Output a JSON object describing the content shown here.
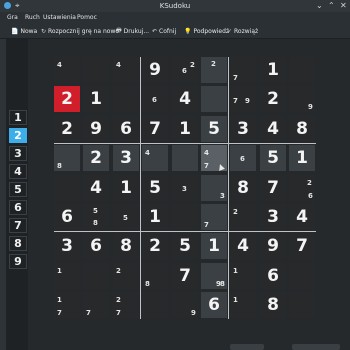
{
  "window": {
    "title": "KSudoku",
    "pin": "⌖",
    "minimize": "⌄",
    "maximize": "⌃",
    "close": "✕"
  },
  "menu": [
    {
      "label": "Gra"
    },
    {
      "label": "Ruch"
    },
    {
      "label": "Ustawienia"
    },
    {
      "label": "Pomoc"
    }
  ],
  "toolbar": [
    {
      "label": "Nowa",
      "icon": "📄"
    },
    {
      "label": "Rozpocznij grę na nowo",
      "icon": "↻"
    },
    {
      "label": "Drukuj...",
      "icon": "🖶"
    },
    {
      "label": "Cofnij",
      "icon": "↶"
    },
    {
      "label": "Podpowiedź",
      "icon": "💡"
    },
    {
      "label": "Rozwiąż",
      "icon": "✓"
    }
  ],
  "number_panel": {
    "selected": "2",
    "buttons": [
      "1",
      "2",
      "3",
      "4",
      "5",
      "6",
      "7",
      "8",
      "9"
    ]
  },
  "board": {
    "selected_cell": {
      "row": 3,
      "col": 5
    },
    "cells": [
      [
        {
          "m": [
            [
              "4",
              "tl"
            ]
          ]
        },
        {},
        {
          "m": [
            [
              "4",
              "tl"
            ]
          ]
        },
        {
          "v": "9"
        },
        {
          "m": [
            [
              "2",
              "tr"
            ],
            [
              "6",
              "mid"
            ]
          ]
        },
        {
          "m": [
            [
              "2",
              "top"
            ]
          ]
        },
        {
          "m": [
            [
              "7",
              "bl"
            ]
          ]
        },
        {
          "v": "1"
        },
        {}
      ],
      [
        {
          "v": "2",
          "err": true
        },
        {
          "v": "1"
        },
        {},
        {
          "m": [
            [
              "6",
              "mid"
            ]
          ]
        },
        {
          "v": "4"
        },
        {},
        {
          "m": [
            [
              "7",
              "ml"
            ],
            [
              "9",
              "mr"
            ]
          ]
        },
        {
          "v": "2"
        },
        {
          "m": [
            [
              "9",
              "br"
            ]
          ]
        }
      ],
      [
        {
          "v": "2"
        },
        {
          "v": "9"
        },
        {
          "v": "6"
        },
        {
          "v": "7"
        },
        {
          "v": "1"
        },
        {
          "v": "5"
        },
        {
          "v": "3"
        },
        {
          "v": "4"
        },
        {
          "v": "8"
        }
      ],
      [
        {
          "m": [
            [
              "8",
              "bl"
            ]
          ]
        },
        {
          "v": "2"
        },
        {
          "v": "3"
        },
        {
          "m": [
            [
              "4",
              "tl"
            ]
          ]
        },
        {},
        {
          "m": [
            [
              "4",
              "tl"
            ],
            [
              "7",
              "bl"
            ]
          ]
        },
        {
          "m": [
            [
              "6",
              "mid"
            ]
          ]
        },
        {
          "v": "5"
        },
        {
          "v": "1"
        }
      ],
      [
        {},
        {
          "v": "4"
        },
        {
          "v": "1"
        },
        {
          "v": "5"
        },
        {
          "m": [
            [
              "3",
              "mid"
            ]
          ]
        },
        {
          "m": [
            [
              "3",
              "br"
            ]
          ]
        },
        {
          "v": "8"
        },
        {
          "v": "7"
        },
        {
          "m": [
            [
              "2",
              "tr"
            ],
            [
              "6",
              "br"
            ]
          ]
        }
      ],
      [
        {
          "v": "6"
        },
        {
          "m": [
            [
              "5",
              "top"
            ],
            [
              "8",
              "bot"
            ]
          ]
        },
        {
          "m": [
            [
              "5",
              "mid"
            ]
          ]
        },
        {
          "v": "1"
        },
        {},
        {
          "m": [
            [
              "7",
              "bl"
            ]
          ]
        },
        {
          "m": [
            [
              "2",
              "tl"
            ]
          ]
        },
        {
          "v": "3"
        },
        {
          "v": "4"
        }
      ],
      [
        {
          "v": "3"
        },
        {
          "v": "6"
        },
        {
          "v": "8"
        },
        {
          "v": "2"
        },
        {
          "v": "5"
        },
        {
          "v": "1"
        },
        {
          "v": "4"
        },
        {
          "v": "9"
        },
        {
          "v": "7"
        }
      ],
      [
        {
          "m": [
            [
              "1",
              "tl"
            ]
          ]
        },
        {},
        {
          "m": [
            [
              "2",
              "tl"
            ]
          ]
        },
        {
          "m": [
            [
              "8",
              "bl"
            ]
          ]
        },
        {
          "v": "7"
        },
        {
          "m": [
            [
              "8",
              "br"
            ],
            [
              "9",
              "br2"
            ]
          ]
        },
        {
          "m": [
            [
              "1",
              "tl"
            ]
          ]
        },
        {
          "v": "6"
        },
        {}
      ],
      [
        {
          "m": [
            [
              "1",
              "tl"
            ],
            [
              "7",
              "bl"
            ]
          ]
        },
        {
          "m": [
            [
              "7",
              "bl"
            ]
          ]
        },
        {
          "m": [
            [
              "2",
              "tl"
            ],
            [
              "7",
              "bl"
            ]
          ]
        },
        {},
        {
          "m": [
            [
              "9",
              "br"
            ]
          ]
        },
        {
          "v": "6"
        },
        {
          "m": [
            [
              "1",
              "tl"
            ]
          ]
        },
        {
          "v": "8"
        },
        {}
      ]
    ]
  }
}
